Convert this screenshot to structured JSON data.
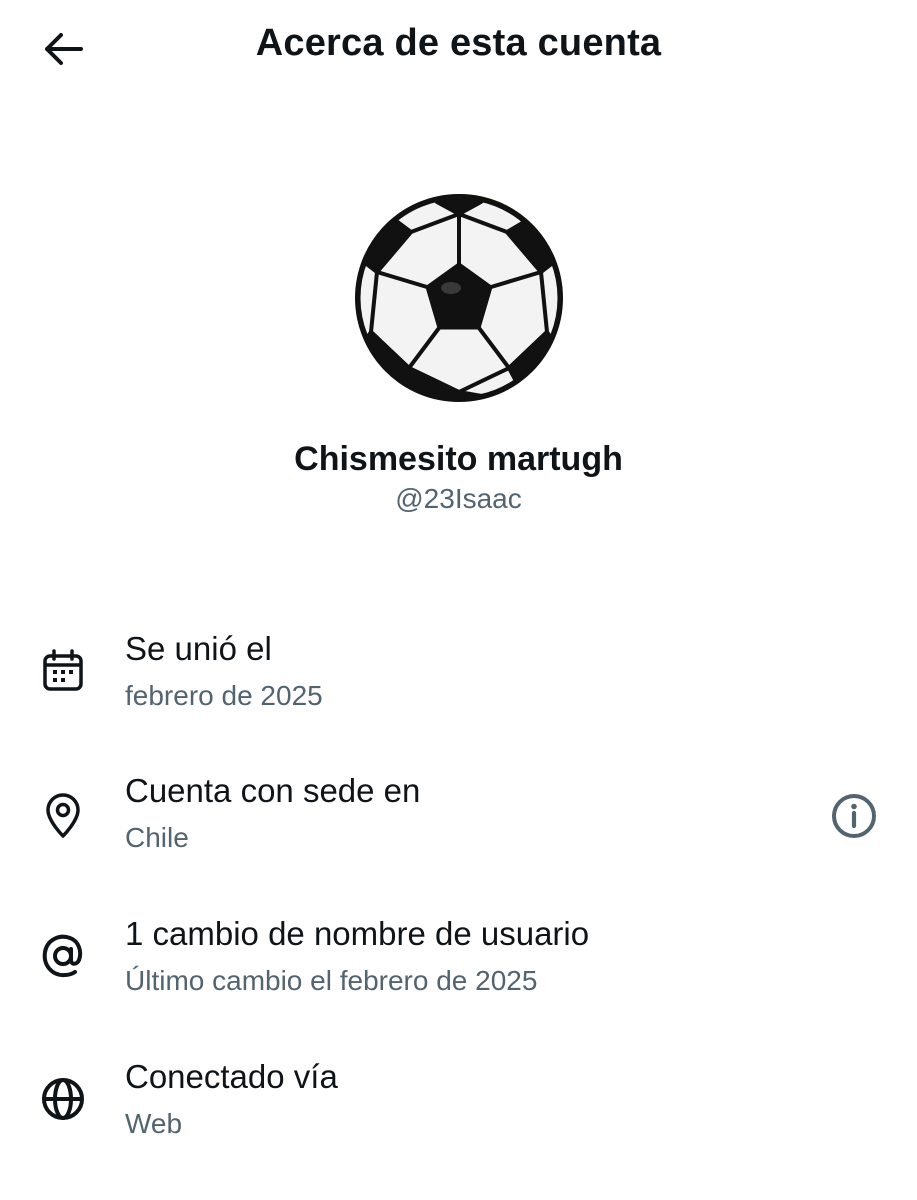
{
  "header": {
    "title": "Acerca de esta cuenta",
    "back_icon": "arrow-left-icon"
  },
  "profile": {
    "display_name": "Chismesito martugh",
    "handle": "@23Isaac",
    "avatar": "soccer-ball"
  },
  "details": [
    {
      "icon": "calendar-icon",
      "label": "Se unió el",
      "value": "febrero de 2025"
    },
    {
      "icon": "location-pin-icon",
      "label": "Cuenta con sede en",
      "value": "Chile",
      "info_icon": "info-icon"
    },
    {
      "icon": "at-sign-icon",
      "label": "1 cambio de nombre de usuario",
      "value": "Último cambio el febrero de 2025"
    },
    {
      "icon": "globe-icon",
      "label": "Conectado vía",
      "value": "Web"
    }
  ],
  "colors": {
    "primary_text": "#0f1419",
    "secondary_text": "#536471",
    "background": "#ffffff"
  }
}
